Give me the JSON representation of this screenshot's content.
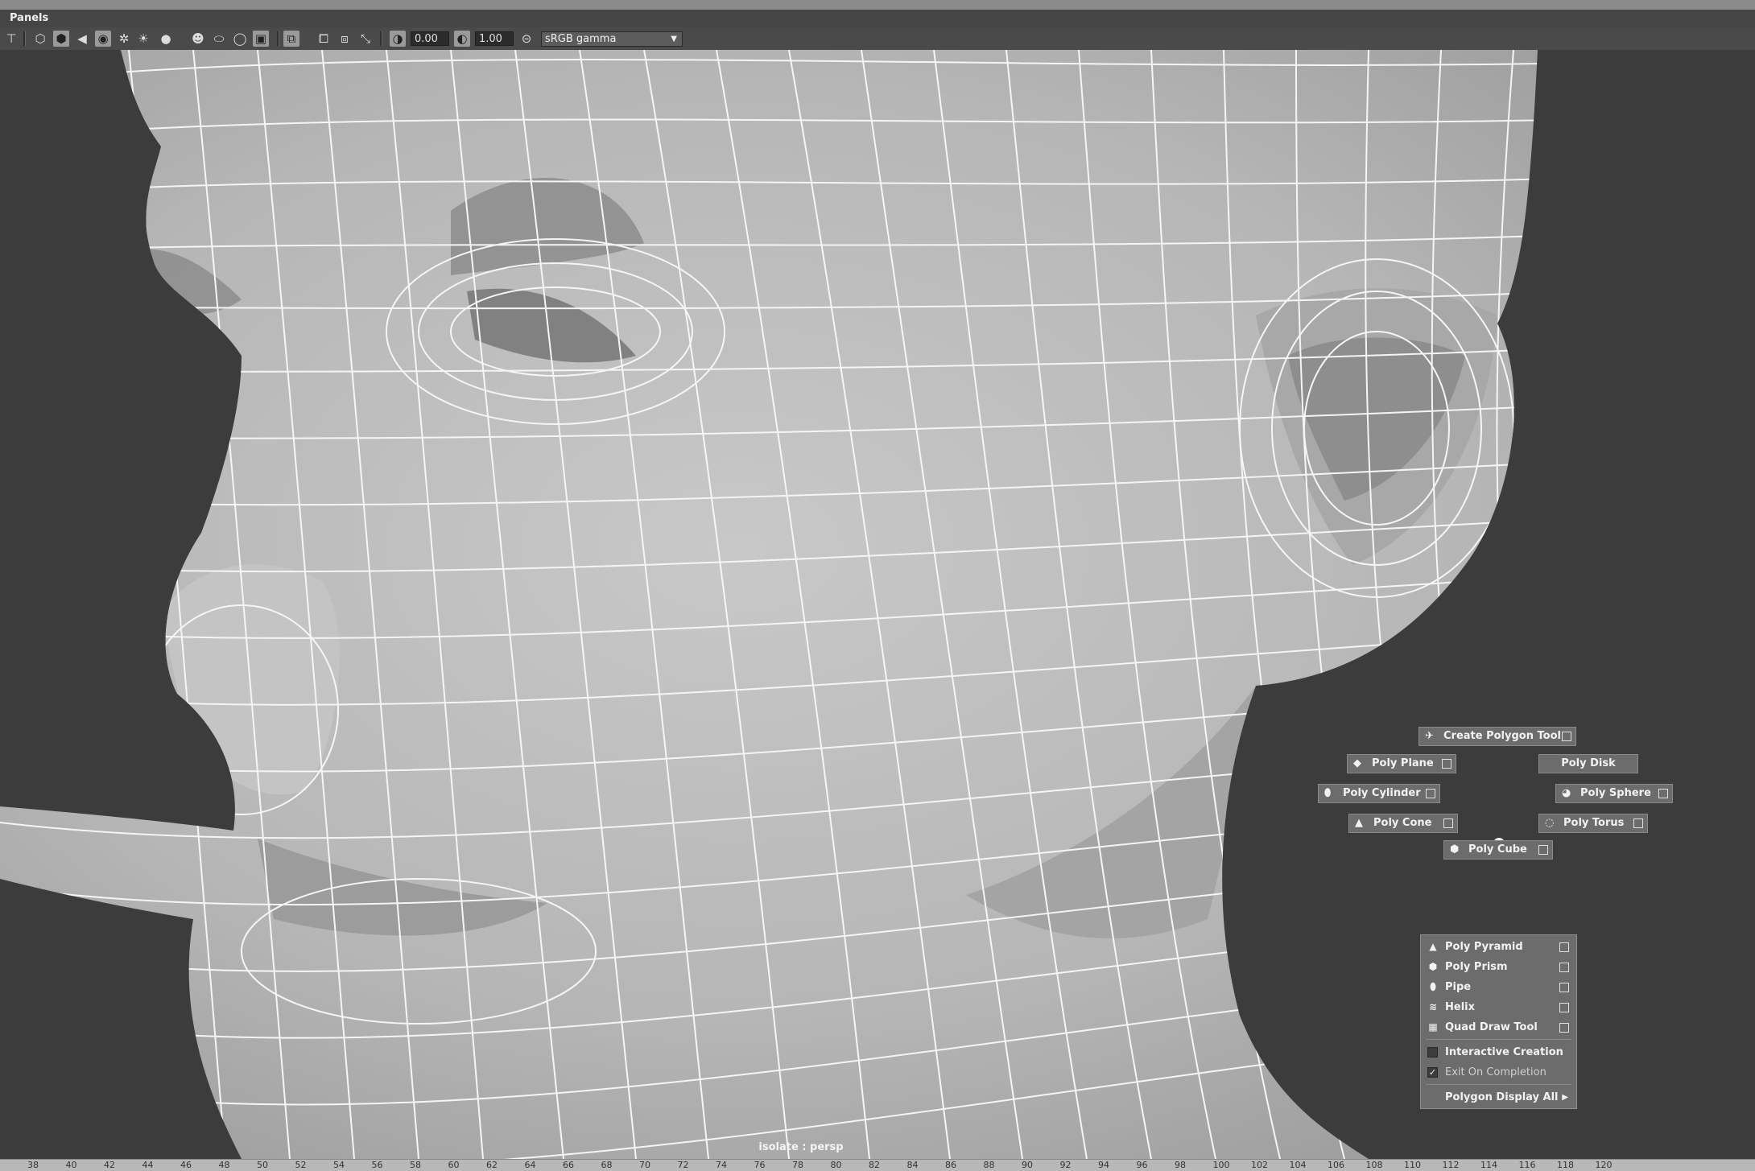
{
  "menu": {
    "panels": "Panels"
  },
  "toolbar": {
    "icons": [
      "camera-attributes-icon",
      "wireframe-icon",
      "smooth-shade-icon",
      "lighting-icon",
      "default-material-icon",
      "textured-icon",
      "use-lights-icon",
      "shadows-icon",
      "ambient-occlusion-icon",
      "motion-blur-icon",
      "anti-aliasing-icon",
      "isolate-select-icon",
      "xray-icon",
      "xray-joints-icon",
      "xray-active-icon",
      "exposure-icon",
      "gamma-icon"
    ],
    "exposure_value": "0.00",
    "gamma_value": "1.00",
    "color_space": "sRGB gamma"
  },
  "viewport": {
    "camera_label": "isolate : persp"
  },
  "marking_menu": {
    "create_polygon_tool": "Create Polygon Tool",
    "poly_plane": "Poly Plane",
    "poly_disk": "Poly Disk",
    "poly_cylinder": "Poly Cylinder",
    "poly_sphere": "Poly Sphere",
    "poly_cone": "Poly Cone",
    "poly_torus": "Poly Torus",
    "poly_cube": "Poly Cube"
  },
  "menu_list": {
    "items": [
      "Poly Pyramid",
      "Poly Prism",
      "Pipe",
      "Helix",
      "Quad Draw Tool"
    ],
    "interactive_creation": "Interactive Creation",
    "exit_on_completion": "Exit On Completion",
    "polygon_display_all": "Polygon Display All"
  },
  "timeline": {
    "ticks": [
      "38",
      "40",
      "42",
      "44",
      "46",
      "48",
      "50",
      "52",
      "54",
      "56",
      "58",
      "60",
      "62",
      "64",
      "66",
      "68",
      "70",
      "72",
      "74",
      "76",
      "78",
      "80",
      "82",
      "84",
      "86",
      "88",
      "90",
      "92",
      "94",
      "96",
      "98",
      "100",
      "102",
      "104",
      "106",
      "108",
      "110",
      "112",
      "114",
      "116",
      "118",
      "120"
    ]
  },
  "colors": {
    "viewport_bg": "#3c3c3c",
    "mesh_fill": "#b9b9b9",
    "wireframe": "#f5f5f5",
    "menu_bg": "#6c6c6c"
  }
}
